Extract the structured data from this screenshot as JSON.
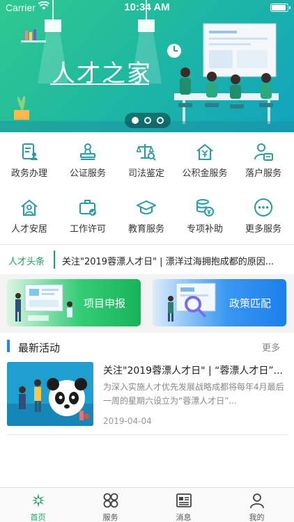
{
  "status_bar": {
    "carrier": "Carrier",
    "time": "10:34 AM"
  },
  "banner": {
    "title": "人才之家",
    "slide_count": 3,
    "active_slide": 1
  },
  "services": [
    {
      "label": "政务办理",
      "icon": "document-user-icon"
    },
    {
      "label": "公证服务",
      "icon": "stamp-icon"
    },
    {
      "label": "司法鉴定",
      "icon": "scale-search-icon"
    },
    {
      "label": "公积金服务",
      "icon": "house-yen-icon"
    },
    {
      "label": "落户服务",
      "icon": "person-card-icon"
    },
    {
      "label": "人才安居",
      "icon": "house-person-icon"
    },
    {
      "label": "工作许可",
      "icon": "briefcase-check-icon"
    },
    {
      "label": "教育服务",
      "icon": "graduation-cap-icon"
    },
    {
      "label": "专项补助",
      "icon": "coins-yen-icon"
    },
    {
      "label": "更多服务",
      "icon": "more-dots-icon"
    }
  ],
  "headline": {
    "tag": "人才头条",
    "text": "关注\"2019蓉漂人才日\" | 漂洋过海拥抱成都的原因..."
  },
  "cards": {
    "project": "项目申报",
    "policy": "政策匹配"
  },
  "activities": {
    "title": "最新活动",
    "more": "更多",
    "items": [
      {
        "title": "关注\"2019蓉漂人才日\" | “蓉漂人才日”...",
        "summary": "为深入实施人才优先发展战略成都将每年4月最后一周的星期六设立为“蓉漂人才日”...",
        "date": "2019-04-04"
      }
    ]
  },
  "tabbar": {
    "active": "home",
    "tabs": [
      {
        "key": "home",
        "label": "首页"
      },
      {
        "key": "services",
        "label": "服务"
      },
      {
        "key": "messages",
        "label": "消息"
      },
      {
        "key": "mine",
        "label": "我的"
      }
    ]
  },
  "colors": {
    "accent_green": "#19a45c",
    "icon_teal": "#2b9ba0",
    "accent_blue": "#1e88e5"
  }
}
